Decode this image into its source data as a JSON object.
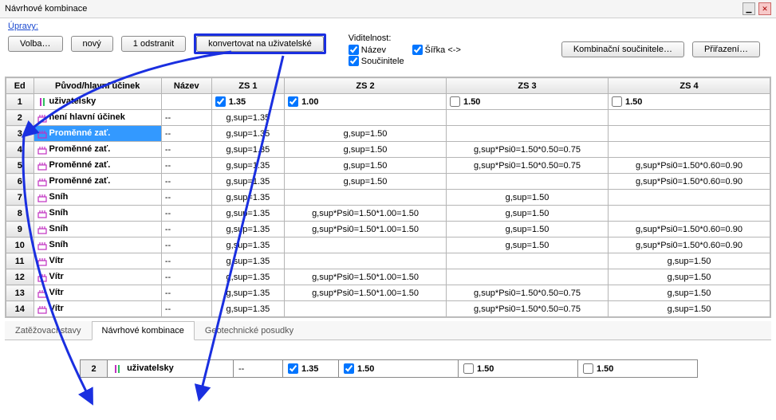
{
  "window": {
    "title": "Návrhové kombinace",
    "minimize_label": "▁",
    "close_label": "✕"
  },
  "toolbar": {
    "upravy": "Úpravy:",
    "volba": "Volba…",
    "novy": "nový",
    "odstranit": "1 odstranit",
    "konvertovat": "konvertovat na uživatelské",
    "visibility_title": "Viditelnost:",
    "vis_nazev": "Název",
    "vis_soucinitele": "Součinitele",
    "vis_sirka": "Šířka <->",
    "kombinacni": "Kombinační součinitele…",
    "prirazeni": "Přiřazení…"
  },
  "columns": {
    "ed": "Ed",
    "puvod": "Původ/hlavní účinek",
    "nazev": "Název",
    "zs1": "ZS 1",
    "zs2": "ZS 2",
    "zs3": "ZS 3",
    "zs4": "ZS 4"
  },
  "rows": [
    {
      "n": "1",
      "icon": "user",
      "puvod": "uživatelsky",
      "nazev": "",
      "zs1": {
        "chk": true,
        "v": "1.35"
      },
      "zs2": {
        "chk": true,
        "v": "1.00"
      },
      "zs3": {
        "chk": false,
        "v": "1.50"
      },
      "zs4": {
        "chk": false,
        "v": "1.50"
      }
    },
    {
      "n": "2",
      "icon": "load",
      "puvod": "není hlavní účinek",
      "nazev": "--",
      "zs1": "g,sup=1.35",
      "zs2": "",
      "zs3": "",
      "zs4": ""
    },
    {
      "n": "3",
      "icon": "load",
      "puvod": "Proměnné zať.",
      "nazev": "--",
      "zs1": "g,sup=1.35",
      "zs2": "g,sup=1.50",
      "zs3": "",
      "zs4": "",
      "selected": true
    },
    {
      "n": "4",
      "icon": "load",
      "puvod": "Proměnné zať.",
      "nazev": "--",
      "zs1": "g,sup=1.35",
      "zs2": "g,sup=1.50",
      "zs3": "g,sup*Psi0=1.50*0.50=0.75",
      "zs4": ""
    },
    {
      "n": "5",
      "icon": "load",
      "puvod": "Proměnné zať.",
      "nazev": "--",
      "zs1": "g,sup=1.35",
      "zs2": "g,sup=1.50",
      "zs3": "g,sup*Psi0=1.50*0.50=0.75",
      "zs4": "g,sup*Psi0=1.50*0.60=0.90"
    },
    {
      "n": "6",
      "icon": "load",
      "puvod": "Proměnné zať.",
      "nazev": "--",
      "zs1": "g,sup=1.35",
      "zs2": "g,sup=1.50",
      "zs3": "",
      "zs4": "g,sup*Psi0=1.50*0.60=0.90"
    },
    {
      "n": "7",
      "icon": "load",
      "puvod": "Sníh",
      "nazev": "--",
      "zs1": "g,sup=1.35",
      "zs2": "",
      "zs3": "g,sup=1.50",
      "zs4": ""
    },
    {
      "n": "8",
      "icon": "load",
      "puvod": "Sníh",
      "nazev": "--",
      "zs1": "g,sup=1.35",
      "zs2": "g,sup*Psi0=1.50*1.00=1.50",
      "zs3": "g,sup=1.50",
      "zs4": ""
    },
    {
      "n": "9",
      "icon": "load",
      "puvod": "Sníh",
      "nazev": "--",
      "zs1": "g,sup=1.35",
      "zs2": "g,sup*Psi0=1.50*1.00=1.50",
      "zs3": "g,sup=1.50",
      "zs4": "g,sup*Psi0=1.50*0.60=0.90"
    },
    {
      "n": "10",
      "icon": "load",
      "puvod": "Sníh",
      "nazev": "--",
      "zs1": "g,sup=1.35",
      "zs2": "",
      "zs3": "g,sup=1.50",
      "zs4": "g,sup*Psi0=1.50*0.60=0.90"
    },
    {
      "n": "11",
      "icon": "load",
      "puvod": "Vítr",
      "nazev": "--",
      "zs1": "g,sup=1.35",
      "zs2": "",
      "zs3": "",
      "zs4": "g,sup=1.50"
    },
    {
      "n": "12",
      "icon": "load",
      "puvod": "Vítr",
      "nazev": "--",
      "zs1": "g,sup=1.35",
      "zs2": "g,sup*Psi0=1.50*1.00=1.50",
      "zs3": "",
      "zs4": "g,sup=1.50"
    },
    {
      "n": "13",
      "icon": "load",
      "puvod": "Vítr",
      "nazev": "--",
      "zs1": "g,sup=1.35",
      "zs2": "g,sup*Psi0=1.50*1.00=1.50",
      "zs3": "g,sup*Psi0=1.50*0.50=0.75",
      "zs4": "g,sup=1.50"
    },
    {
      "n": "14",
      "icon": "load",
      "puvod": "Vítr",
      "nazev": "--",
      "zs1": "g,sup=1.35",
      "zs2": "",
      "zs3": "g,sup*Psi0=1.50*0.50=0.75",
      "zs4": "g,sup=1.50"
    }
  ],
  "tabs": {
    "t1": "Zatěžovací stavy",
    "t2": "Návrhové kombinace",
    "t3": "Geotechnické posudky"
  },
  "bottom": {
    "n": "2",
    "puvod": "uživatelsky",
    "nazev": "--",
    "zs1": {
      "chk": true,
      "v": "1.35"
    },
    "zs2": {
      "chk": true,
      "v": "1.50"
    },
    "zs3": {
      "chk": false,
      "v": "1.50"
    },
    "zs4": {
      "chk": false,
      "v": "1.50"
    }
  }
}
